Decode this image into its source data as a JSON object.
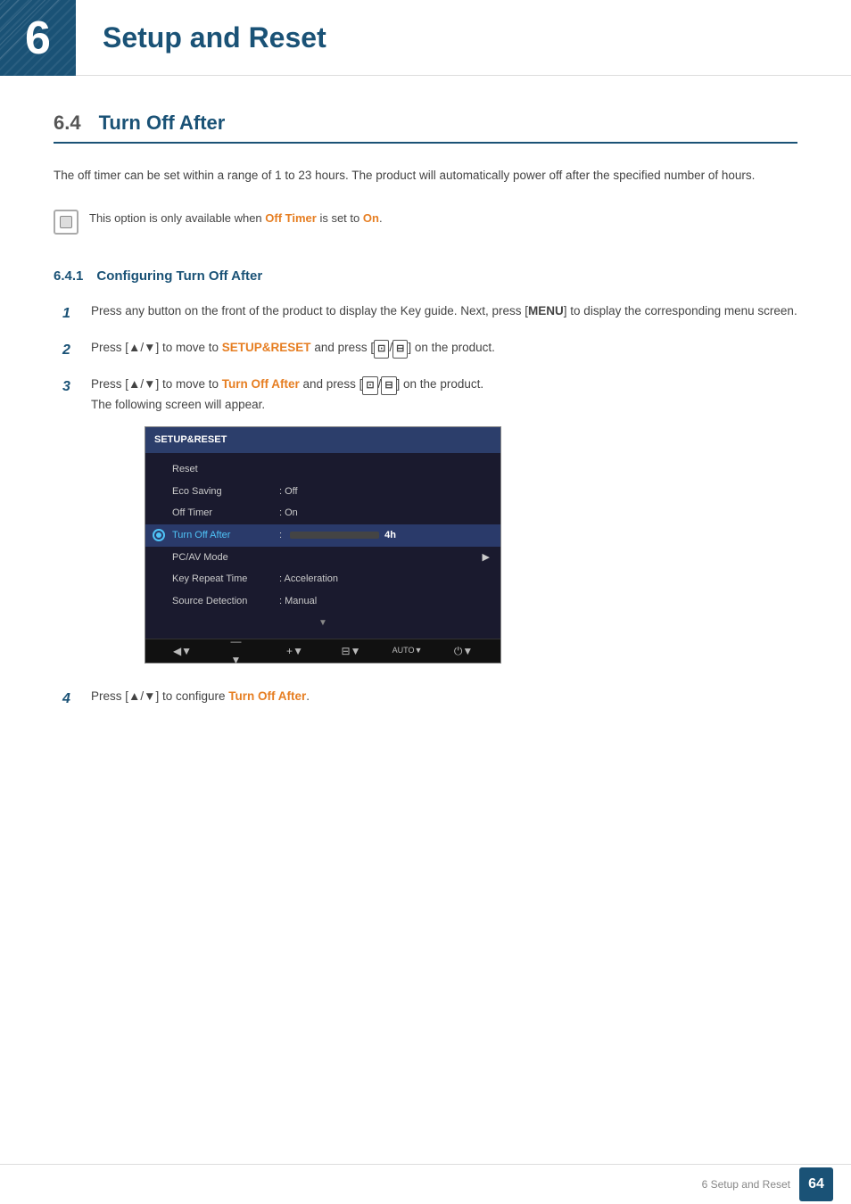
{
  "header": {
    "chapter_num": "6",
    "title": "Setup and Reset"
  },
  "section": {
    "number": "6.4",
    "title": "Turn Off After",
    "intro": "The off timer can be set within a range of 1 to 23 hours. The product will automatically power off after the specified number of hours.",
    "note": {
      "text_before": "This option is only available when ",
      "highlight1": "Off Timer",
      "text_middle": " is set to ",
      "highlight2": "On",
      "text_after": "."
    }
  },
  "subsection": {
    "number": "6.4.1",
    "title": "Configuring Turn Off After"
  },
  "steps": [
    {
      "num": "1",
      "text_before": "Press any button on the front of the product to display the Key guide. Next, press [",
      "bold": "MENU",
      "text_after": "] to display the corresponding menu screen."
    },
    {
      "num": "2",
      "text_before": "Press [▲/▼] to move to ",
      "highlight": "SETUP&RESET",
      "text_after": " and press [⊡/⊟] on the product."
    },
    {
      "num": "3",
      "text_before": "Press [▲/▼] to move to ",
      "highlight": "Turn Off After",
      "text_after": " and press [⊡/⊟] on the product.",
      "sub_note": "The following screen will appear."
    },
    {
      "num": "4",
      "text_before": "Press [▲/▼] to configure ",
      "highlight": "Turn Off After",
      "text_after": "."
    }
  ],
  "menu_screenshot": {
    "title": "SETUP&RESET",
    "items": [
      {
        "label": "Reset",
        "value": "",
        "active": false,
        "indent": false
      },
      {
        "label": "Eco Saving",
        "value": ": Off",
        "active": false,
        "indent": true
      },
      {
        "label": "Off Timer",
        "value": ": On",
        "active": false,
        "indent": true
      },
      {
        "label": "Turn Off After",
        "value": "",
        "active": true,
        "indent": true,
        "has_progress": true,
        "progress": 17,
        "progress_label": "4h"
      },
      {
        "label": "PC/AV Mode",
        "value": "",
        "active": false,
        "indent": true,
        "has_arrow": true
      },
      {
        "label": "Key Repeat Time",
        "value": ": Acceleration",
        "active": false,
        "indent": true
      },
      {
        "label": "Source Detection",
        "value": ": Manual",
        "active": false,
        "indent": true
      }
    ],
    "toolbar_buttons": [
      {
        "icon": "◀",
        "label": ""
      },
      {
        "icon": "—",
        "label": ""
      },
      {
        "icon": "+",
        "label": ""
      },
      {
        "icon": "⊟",
        "label": ""
      },
      {
        "icon": "AUTO",
        "label": ""
      },
      {
        "icon": "⏻",
        "label": ""
      }
    ]
  },
  "footer": {
    "text": "6 Setup and Reset",
    "page": "64"
  }
}
